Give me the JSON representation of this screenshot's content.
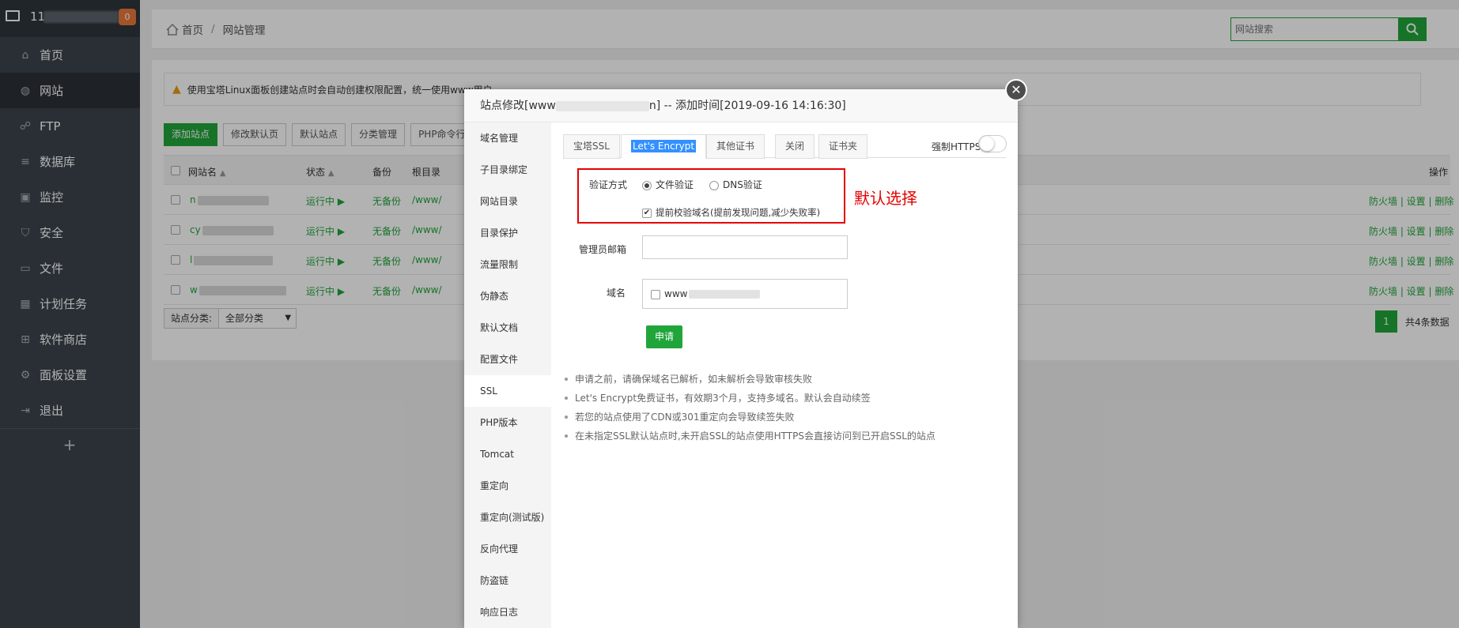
{
  "sidebar": {
    "server_label": "11",
    "badge": "0",
    "items": [
      {
        "label": "首页",
        "icon": "home-icon",
        "glyph": "⌂"
      },
      {
        "label": "网站",
        "icon": "globe-icon",
        "glyph": "◍"
      },
      {
        "label": "FTP",
        "icon": "ftp-icon",
        "glyph": "☍"
      },
      {
        "label": "数据库",
        "icon": "database-icon",
        "glyph": "≡"
      },
      {
        "label": "监控",
        "icon": "monitor-icon",
        "glyph": "▣"
      },
      {
        "label": "安全",
        "icon": "shield-icon",
        "glyph": "⛉"
      },
      {
        "label": "文件",
        "icon": "folder-icon",
        "glyph": "▭"
      },
      {
        "label": "计划任务",
        "icon": "calendar-icon",
        "glyph": "▦"
      },
      {
        "label": "软件商店",
        "icon": "apps-icon",
        "glyph": "⊞"
      },
      {
        "label": "面板设置",
        "icon": "gear-icon",
        "glyph": "⚙"
      },
      {
        "label": "退出",
        "icon": "logout-icon",
        "glyph": "⇥"
      }
    ],
    "add": "+"
  },
  "header": {
    "breadcrumb_home": "首页",
    "breadcrumb_sep": "/",
    "breadcrumb_current": "网站管理",
    "search_placeholder": "网站搜索"
  },
  "notice": {
    "text": "使用宝塔Linux面板创建站点时会自动创建权限配置，统一使用www用户"
  },
  "toolbar": {
    "buttons": [
      "添加站点",
      "修改默认页",
      "默认站点",
      "分类管理",
      "PHP命令行"
    ]
  },
  "table": {
    "headers": {
      "name": "网站名",
      "status": "状态",
      "backup": "备份",
      "root": "根目录",
      "actions": "操作"
    },
    "rows": [
      {
        "name": "n",
        "status": "运行中 ▶",
        "backup": "无备份",
        "root": "/www/"
      },
      {
        "name": "cy",
        "status": "运行中 ▶",
        "backup": "无备份",
        "root": "/www/"
      },
      {
        "name": "l",
        "status": "运行中 ▶",
        "backup": "无备份",
        "root": "/www/"
      },
      {
        "name": "w",
        "status": "运行中 ▶",
        "backup": "无备份",
        "root": "/www/"
      }
    ],
    "row_actions": "防火墙 | 设置 | 删除"
  },
  "filter": {
    "label": "站点分类:",
    "value": "全部分类",
    "arrow": "▼"
  },
  "pager": {
    "page": "1",
    "total": "共4条数据"
  },
  "modal": {
    "title_prefix": "站点修改[www",
    "title_suffix": "] -- 添加时间[2019-09-16 14:16:30]",
    "close": "✕",
    "nav": [
      "域名管理",
      "子目录绑定",
      "网站目录",
      "目录保护",
      "流量限制",
      "伪静态",
      "默认文档",
      "配置文件",
      "SSL",
      "PHP版本",
      "Tomcat",
      "重定向",
      "重定向(测试版)",
      "反向代理",
      "防盗链",
      "响应日志"
    ],
    "tabs": [
      "宝塔SSL",
      "Let's Encrypt",
      "其他证书",
      "关闭",
      "证书夹"
    ],
    "force_https": "强制HTTPS",
    "verify_label": "验证方式",
    "verify_file": "文件验证",
    "verify_dns": "DNS验证",
    "precheck": "提前校验域名(提前发现问题,减少失败率)",
    "email_label": "管理员邮箱",
    "domain_label": "域名",
    "domain_value": "www",
    "apply": "申请",
    "annotation": "默认选择",
    "notes": [
      "申请之前，请确保域名已解析，如未解析会导致审核失败",
      "Let's Encrypt免费证书，有效期3个月，支持多域名。默认会自动续签",
      "若您的站点使用了CDN或301重定向会导致续签失败",
      "在未指定SSL默认站点时,未开启SSL的站点使用HTTPS会直接访问到已开启SSL的站点"
    ]
  }
}
